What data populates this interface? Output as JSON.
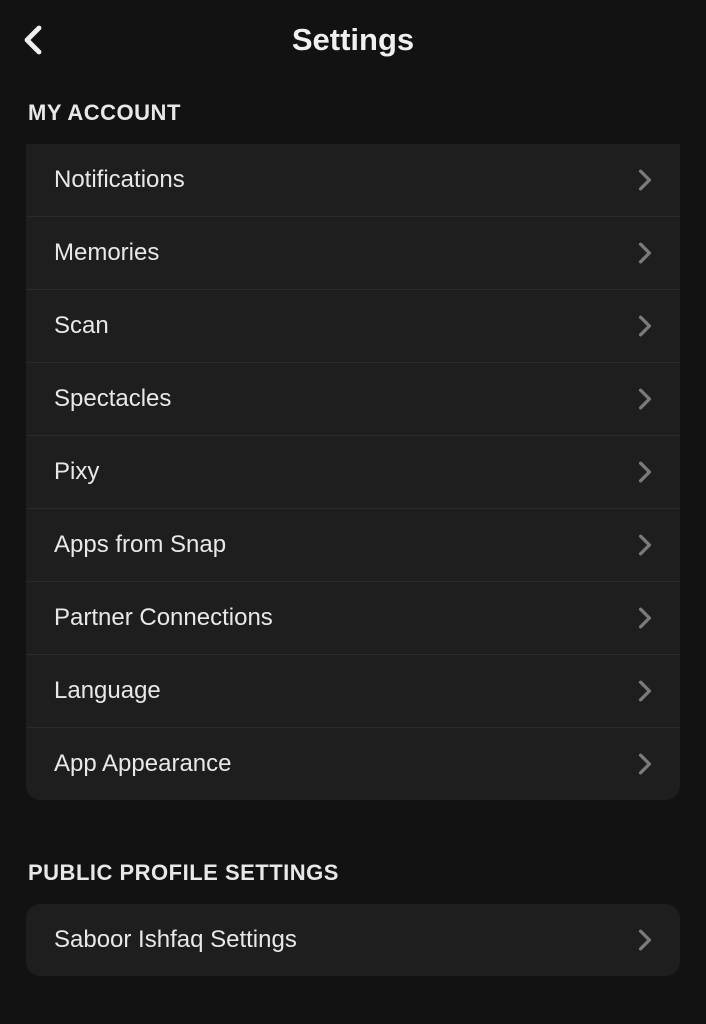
{
  "header": {
    "title": "Settings"
  },
  "sections": {
    "myAccount": {
      "header": "MY ACCOUNT",
      "items": [
        {
          "label": "Notifications"
        },
        {
          "label": "Memories"
        },
        {
          "label": "Scan"
        },
        {
          "label": "Spectacles"
        },
        {
          "label": "Pixy"
        },
        {
          "label": "Apps from Snap"
        },
        {
          "label": "Partner Connections"
        },
        {
          "label": "Language"
        },
        {
          "label": "App Appearance"
        }
      ]
    },
    "publicProfile": {
      "header": "PUBLIC PROFILE SETTINGS",
      "items": [
        {
          "label": "Saboor Ishfaq Settings"
        }
      ]
    }
  }
}
